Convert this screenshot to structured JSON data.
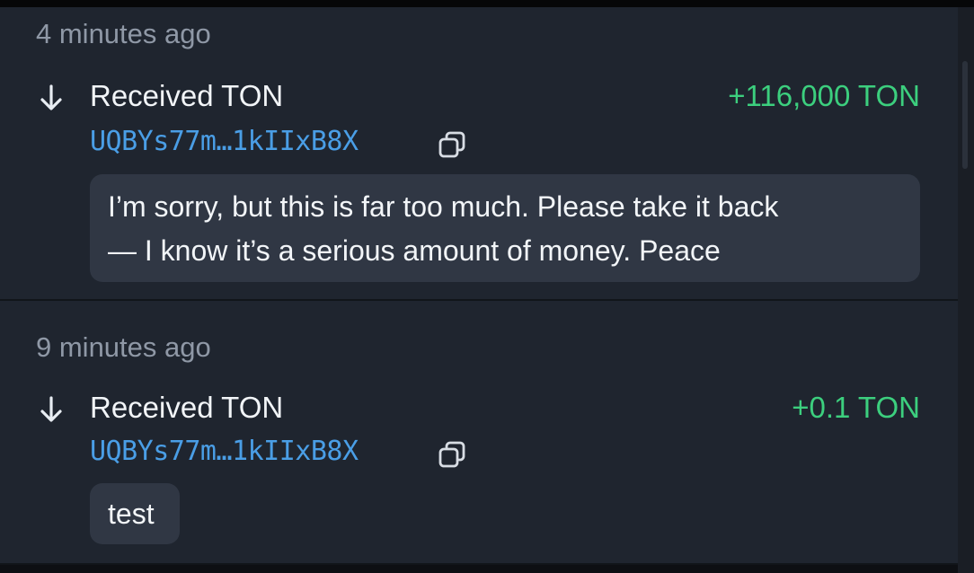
{
  "transactions": [
    {
      "time": "4 minutes ago",
      "title": "Received TON",
      "amount": "+116,000 TON",
      "address": "UQBYs77m…1kIIxB8X",
      "comment": "I’m sorry, but this is far too much. Please take it back — I know it’s a serious amount of money. Peace",
      "comment_lines": [
        "I’m sorry, but this is far too much. Please take it back",
        "— I know it’s a serious amount of money. Peace"
      ]
    },
    {
      "time": "9 minutes ago",
      "title": "Received TON",
      "amount": "+0.1 TON",
      "address": "UQBYs77m…1kIIxB8X",
      "comment": "test"
    }
  ],
  "icons": {
    "direction": "arrow-down-icon",
    "copy": "copy-icon"
  },
  "colors": {
    "background": "#1f252f",
    "amount_positive": "#3ccf7e",
    "address_link": "#4a9ee6",
    "muted_text": "#8f98a6",
    "comment_bubble": "#303744"
  }
}
